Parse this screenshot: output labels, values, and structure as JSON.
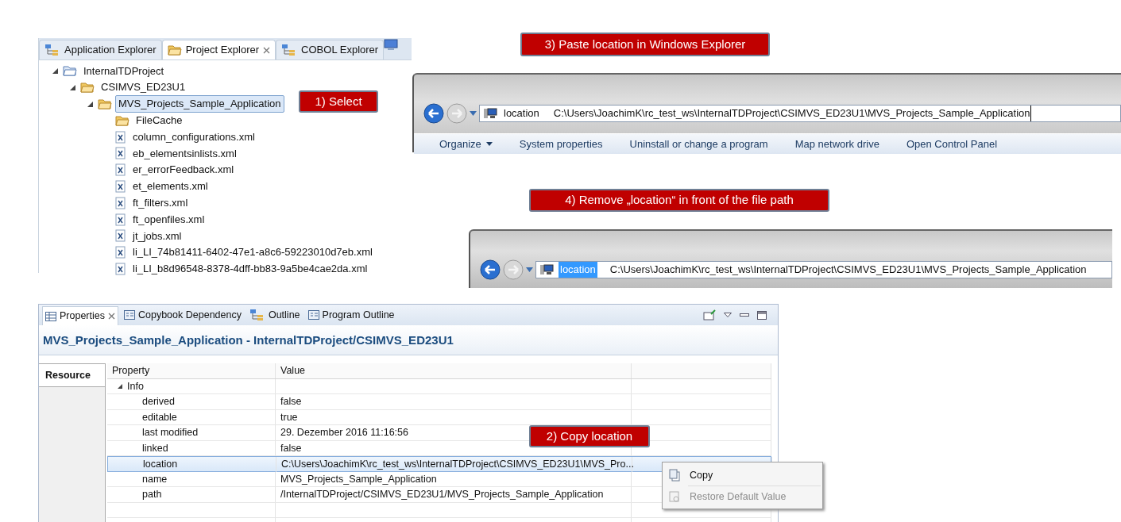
{
  "project_explorer": {
    "tabs": [
      {
        "label": "Application Explorer",
        "selected": false,
        "closable": false
      },
      {
        "label": "Project Explorer",
        "selected": true,
        "closable": true
      },
      {
        "label": "COBOL Explorer",
        "selected": false,
        "closable": false
      }
    ],
    "tree": [
      {
        "label": "InternalTDProject",
        "kind": "project",
        "expanded": true,
        "selected": false,
        "children": [
          {
            "label": "CSIMVS_ED23U1",
            "kind": "folder",
            "expanded": true,
            "selected": false,
            "children": [
              {
                "label": "MVS_Projects_Sample_Application",
                "kind": "folder",
                "expanded": true,
                "selected": true,
                "children": [
                  {
                    "label": "FileCache",
                    "kind": "folder",
                    "selected": false
                  },
                  {
                    "label": "column_configurations.xml",
                    "kind": "file",
                    "selected": false
                  },
                  {
                    "label": "eb_elementsinlists.xml",
                    "kind": "file",
                    "selected": false
                  },
                  {
                    "label": "er_errorFeedback.xml",
                    "kind": "file",
                    "selected": false
                  },
                  {
                    "label": "et_elements.xml",
                    "kind": "file",
                    "selected": false
                  },
                  {
                    "label": "ft_filters.xml",
                    "kind": "file",
                    "selected": false
                  },
                  {
                    "label": "ft_openfiles.xml",
                    "kind": "file",
                    "selected": false
                  },
                  {
                    "label": "jt_jobs.xml",
                    "kind": "file",
                    "selected": false
                  },
                  {
                    "label": "li_LI_74b81411-6402-47e1-a8c6-59223010d7eb.xml",
                    "kind": "file",
                    "selected": false
                  },
                  {
                    "label": "li_LI_b8d96548-8378-4dff-bb83-9a5be4cae2da.xml",
                    "kind": "file",
                    "selected": false
                  }
                ]
              }
            ]
          }
        ]
      }
    ],
    "callout": "1) Select"
  },
  "explorer_paste": {
    "callout": "3) Paste location in Windows Explorer",
    "address_label": "location",
    "address_path": "C:\\Users\\JoachimK\\rc_test_ws\\InternalTDProject\\CSIMVS_ED23U1\\MVS_Projects_Sample_Application",
    "label_selected": false,
    "cursor": true,
    "toolbar": [
      {
        "label": "Organize",
        "dropdown": true
      },
      {
        "label": "System properties",
        "dropdown": false
      },
      {
        "label": "Uninstall or change a program",
        "dropdown": false
      },
      {
        "label": "Map network drive",
        "dropdown": false
      },
      {
        "label": "Open Control Panel",
        "dropdown": false
      }
    ]
  },
  "explorer_edit": {
    "callout": "4) Remove „location“ in front of the file path",
    "address_label": "location",
    "address_path": "C:\\Users\\JoachimK\\rc_test_ws\\InternalTDProject\\CSIMVS_ED23U1\\MVS_Projects_Sample_Application",
    "label_selected": true,
    "cursor": false
  },
  "properties": {
    "tabs": [
      {
        "label": "Properties",
        "selected": true,
        "closable": true
      },
      {
        "label": "Copybook Dependency",
        "selected": false,
        "closable": false
      },
      {
        "label": "Outline",
        "selected": false,
        "closable": false
      },
      {
        "label": "Program Outline",
        "selected": false,
        "closable": false
      }
    ],
    "title": "MVS_Projects_Sample_Application - InternalTDProject/CSIMVS_ED23U1",
    "side_tabs": [
      {
        "label": "Resource",
        "selected": true
      }
    ],
    "columns": [
      "Property",
      "Value"
    ],
    "rows": [
      {
        "property": "Info",
        "kind": "category",
        "expanded": true,
        "selected": false
      },
      {
        "property": "derived",
        "value": "false",
        "kind": "property",
        "selected": false
      },
      {
        "property": "editable",
        "value": "true",
        "kind": "property",
        "selected": false
      },
      {
        "property": "last modified",
        "value": "29. Dezember 2016 11:16:56",
        "kind": "property",
        "selected": false
      },
      {
        "property": "linked",
        "value": "false",
        "kind": "property",
        "selected": false
      },
      {
        "property": "location",
        "value": "C:\\Users\\JoachimK\\rc_test_ws\\InternalTDProject\\CSIMVS_ED23U1\\MVS_Pro...",
        "kind": "property",
        "selected": true
      },
      {
        "property": "name",
        "value": "MVS_Projects_Sample_Application",
        "kind": "property",
        "selected": false
      },
      {
        "property": "path",
        "value": "/InternalTDProject/CSIMVS_ED23U1/MVS_Projects_Sample_Application",
        "kind": "property",
        "selected": false
      }
    ],
    "callout": "2) Copy location",
    "context_menu": [
      {
        "label": "Copy",
        "disabled": false
      },
      {
        "label": "Restore Default Value",
        "disabled": true
      }
    ]
  }
}
